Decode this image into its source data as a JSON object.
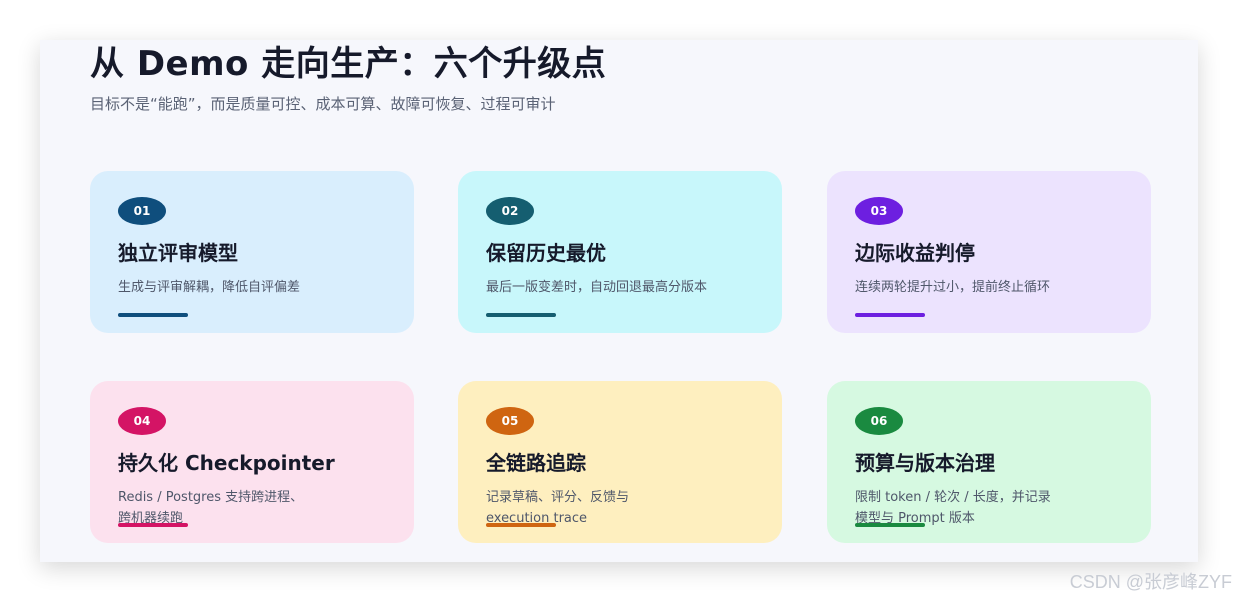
{
  "slide": {
    "title": "从 Demo 走向生产：六个升级点",
    "subtitle": "目标不是“能跑”，而是质量可控、成本可算、故障可恢复、过程可审计"
  },
  "cards": [
    {
      "number": "01",
      "title": "独立评审模型",
      "description_lines": [
        "生成与评审解耦，降低自评偏差"
      ],
      "background_color": "#d9eefd",
      "accent_color": "#0f4e7d"
    },
    {
      "number": "02",
      "title": "保留历史最优",
      "description_lines": [
        "最后一版变差时，自动回退最高分版本"
      ],
      "background_color": "#c8f7fb",
      "accent_color": "#155e70"
    },
    {
      "number": "03",
      "title": "边际收益判停",
      "description_lines": [
        "连续两轮提升过小，提前终止循环"
      ],
      "background_color": "#ece3fe",
      "accent_color": "#6d1fe0"
    },
    {
      "number": "04",
      "title": "持久化 Checkpointer",
      "description_lines": [
        "Redis / Postgres 支持跨进程、",
        "跨机器续跑"
      ],
      "background_color": "#fce1ee",
      "accent_color": "#d41465"
    },
    {
      "number": "05",
      "title": "全链路追踪",
      "description_lines": [
        "记录草稿、评分、反馈与",
        "execution trace"
      ],
      "background_color": "#feefbf",
      "accent_color": "#cf6511"
    },
    {
      "number": "06",
      "title": "预算与版本治理",
      "description_lines": [
        "限制 token / 轮次 / 长度，并记录",
        "模型与 Prompt 版本"
      ],
      "background_color": "#d6f9e1",
      "accent_color": "#1a8a40"
    }
  ],
  "watermark": "CSDN @张彦峰ZYF"
}
